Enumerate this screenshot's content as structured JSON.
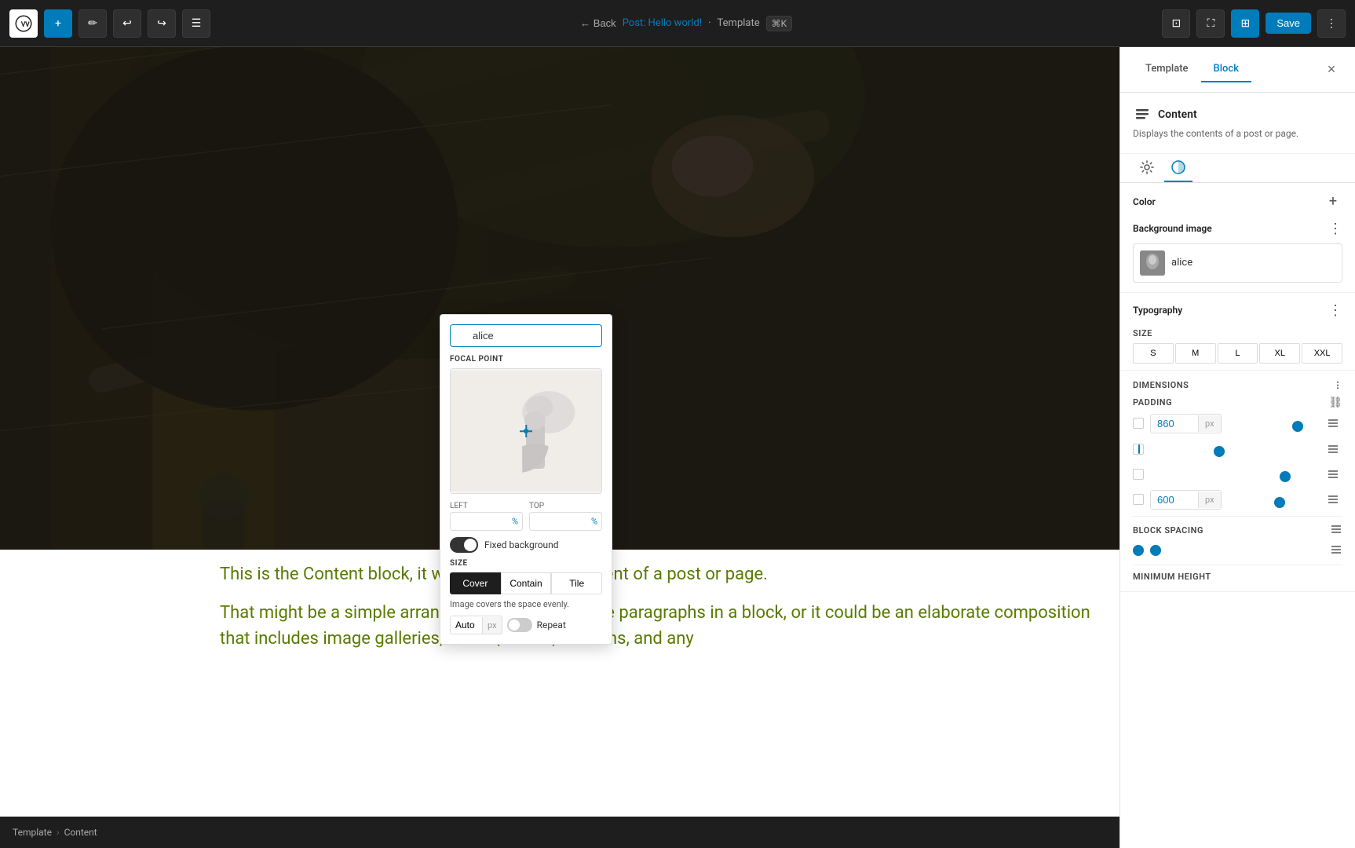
{
  "topbar": {
    "back_label": "← Back",
    "post_link": "Post: Hello world!",
    "separator": "·",
    "template_label": "Template",
    "cmd_label": "⌘K",
    "save_label": "Save",
    "close_label": "×"
  },
  "toolbar_items": [
    {
      "icon": "≡",
      "name": "list-view"
    },
    {
      "icon": "▣",
      "name": "block-view"
    },
    {
      "icon": "⋮",
      "name": "more-options"
    }
  ],
  "breadcrumb": {
    "template": "Template",
    "sep": "›",
    "content": "Content"
  },
  "popup": {
    "search_value": "alice",
    "search_placeholder": "alice",
    "focal_point_label": "FOCAL POINT",
    "left_label": "LEFT",
    "top_label": "TOP",
    "left_value": "",
    "top_value": "",
    "coord_suffix": "%",
    "fixed_bg_label": "Fixed background",
    "size_label": "SIZE",
    "cover_label": "Cover",
    "contain_label": "Contain",
    "tile_label": "Tile",
    "size_hint": "Image covers the space evenly.",
    "auto_label": "Auto",
    "auto_suffix": "px",
    "repeat_label": "Repeat"
  },
  "right_panel": {
    "tab_template": "Template",
    "tab_block": "Block",
    "block_name": "Content",
    "block_desc": "Displays the contents of a post or page.",
    "color_label": "Color",
    "bg_image_label": "Background image",
    "bg_image_name": "alice",
    "typography_label": "Typography",
    "size_label": "SIZE",
    "size_options": [
      "S",
      "M",
      "L",
      "XL",
      "XXL"
    ],
    "dimensions_label": "Dimensions",
    "padding_label": "PADDING",
    "padding_value_1": "860",
    "padding_unit_1": "px",
    "padding_value_2": "600",
    "padding_unit_2": "px",
    "block_spacing_label": "BLOCK SPACING",
    "min_height_label": "MINIMUM HEIGHT"
  },
  "content_text": {
    "para1": "This is the Content block, it will display all the content of a post or page.",
    "para2": "That might be a simple arrangement of consecutive paragraphs in a block, or it could be an elaborate composition that includes image galleries, videos, tables, columns, and any"
  }
}
